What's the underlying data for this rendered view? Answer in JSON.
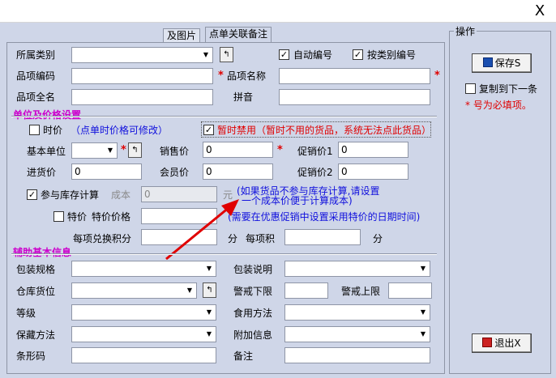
{
  "window": {
    "close": "X"
  },
  "tabs": [
    "及图片",
    "点单关联备注"
  ],
  "ops": {
    "title": "操作",
    "save_label": "保存S",
    "copy_label": "复制到下一条",
    "required_note": "* 号为必填项。",
    "exit_label": "退出X"
  },
  "basic": {
    "category_label": "所属类别",
    "auto_code_label": "自动编号",
    "by_category_label": "按类别编号",
    "code_label": "品项编码",
    "name_label": "品项名称",
    "fullname_label": "品项全名",
    "pinyin_label": "拼音"
  },
  "unit_section": {
    "title": "单位及价格设置",
    "time_price_label": "时价",
    "time_price_note": "（点单时价格可修改）",
    "disabled_label": "暂时禁用（暂时不用的货品，系统无法点此货品）",
    "base_unit_label": "基本单位",
    "sale_price_label": "销售价",
    "sale_price_value": "0",
    "promo1_label": "促销价1",
    "promo1_value": "0",
    "purchase_label": "进货价",
    "purchase_value": "0",
    "member_label": "会员价",
    "member_value": "0",
    "promo2_label": "促销价2",
    "promo2_value": "0",
    "inventory_label": "参与库存计算",
    "cost_label": "成本",
    "cost_value": "0",
    "yuan": "元",
    "cost_note_line1": "(如果货品不参与库存计算,请设置",
    "cost_note_line2": "一个成本价便于计算成本)",
    "special_label": "特价",
    "special_price_label": "特价价格",
    "special_note": "(需要在优惠促销中设置采用特价的日期时间)",
    "points_label": "每项兑换积分",
    "points_unit": "分",
    "per_points_label": "每项积",
    "per_points_unit": "分"
  },
  "aux_section": {
    "title": "辅助基本信息",
    "packspec_label": "包装规格",
    "packdesc_label": "包装说明",
    "warehouse_label": "仓库货位",
    "lowwarn_label": "警戒下限",
    "highwarn_label": "警戒上限",
    "grade_label": "等级",
    "eatmethod_label": "食用方法",
    "storage_label": "保藏方法",
    "extra_label": "附加信息",
    "barcode_label": "条形码",
    "remark_label": "备注"
  },
  "colors": {
    "section": "#cc00cc",
    "required": "#e00000",
    "note": "#1010dd",
    "arrow": "#e00000"
  },
  "icons": {
    "close": "close-icon",
    "save": "save-icon",
    "exit": "exit-icon",
    "lookup": "lookup-icon",
    "dropdown": "dropdown-arrow-icon"
  }
}
